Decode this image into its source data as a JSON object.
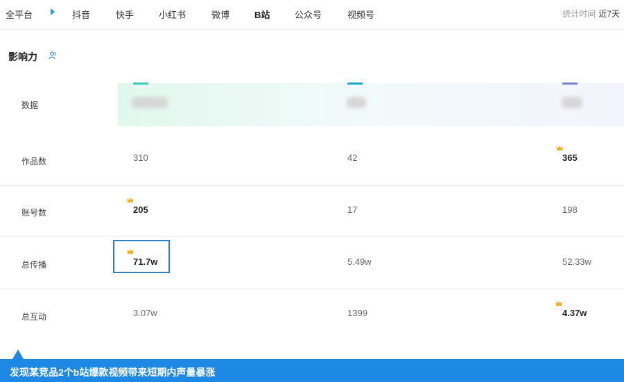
{
  "nav": {
    "items": [
      {
        "label": "全平台"
      },
      {
        "label": "抖音"
      },
      {
        "label": "快手"
      },
      {
        "label": "小红书"
      },
      {
        "label": "微博"
      },
      {
        "label": "B站"
      },
      {
        "label": "公众号"
      },
      {
        "label": "视频号"
      }
    ],
    "active": "B站",
    "stat_label": "统计时间",
    "stat_value": "近7天"
  },
  "section": {
    "title": "影响力",
    "icon": "user-group-icon"
  },
  "table": {
    "accent_colors": [
      "#3cc8b4",
      "#1aa5c9",
      "#7b7fd0"
    ],
    "rows": [
      {
        "label": "数据"
      },
      {
        "label": "作品数",
        "values": [
          "310",
          "42",
          "365"
        ],
        "top_index": 2
      },
      {
        "label": "账号数",
        "values": [
          "205",
          "17",
          "198"
        ],
        "top_index": 0
      },
      {
        "label": "总传播",
        "values": [
          "71.7w",
          "5.49w",
          "52.33w"
        ],
        "top_index": 0
      },
      {
        "label": "总互动",
        "values": [
          "3.07w",
          "1399",
          "4.37w"
        ],
        "top_index": 2
      }
    ]
  },
  "caption": {
    "text": "发现某竞品2个b站爆款视频带来短期内声量暴涨"
  }
}
